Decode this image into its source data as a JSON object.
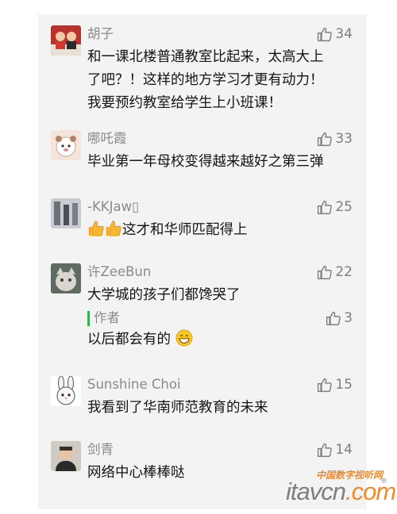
{
  "comments": [
    {
      "name": "胡子",
      "likes": "34",
      "lines": [
        "和一课北楼普通教室比起来，太高大上",
        "了吧？！这样的地方学习才更有动力！",
        "我要预约教室给学生上小班课！"
      ]
    },
    {
      "name": "哪吒霞",
      "likes": "33",
      "lines": [
        "毕业第一年母校变得越来越好之第三弹"
      ]
    },
    {
      "name": "-KKJaw▯",
      "likes": "25",
      "text": "这才和华师匹配得上"
    },
    {
      "name": "许ZeeBun",
      "likes": "22",
      "lines": [
        "大学城的孩子们都馋哭了"
      ],
      "reply": {
        "name": "作者",
        "likes": "3",
        "text": "以后都会有的"
      }
    },
    {
      "name": "Sunshine Choi",
      "likes": "15",
      "lines": [
        "我看到了华南师范教育的未来"
      ]
    },
    {
      "name": "剑青",
      "likes": "14",
      "lines": [
        "网络中心棒棒哒"
      ]
    }
  ],
  "watermark": {
    "top": "中国数字视听网",
    "main_a": "itavcn",
    "main_b": ".com",
    "reg": "®"
  },
  "colors": {
    "panel": "#f3f3f3",
    "name": "#8a8a8a",
    "reply_bar": "#36b04f",
    "watermark_accent": "#f08a2a"
  }
}
